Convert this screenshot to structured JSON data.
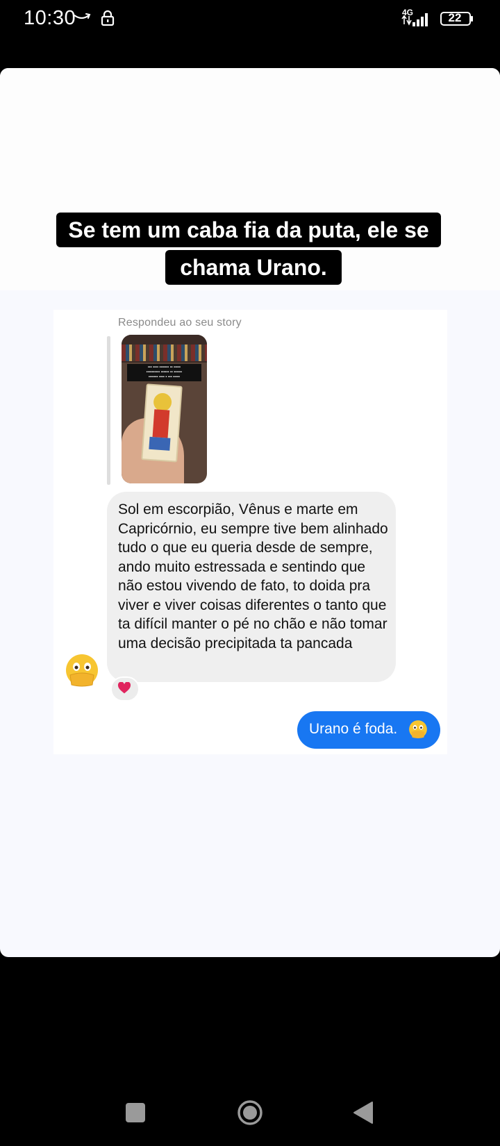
{
  "status_bar": {
    "time": "10:30",
    "network": "4G",
    "battery": "22",
    "icons": [
      "amazon-icon",
      "lock-icon",
      "signal-icon",
      "battery-icon"
    ]
  },
  "story": {
    "caption_line1": "Se tem um caba fia da puta, ele se",
    "caption_line2": "chama Urano."
  },
  "dm": {
    "reply_label": "Respondeu ao seu story",
    "incoming_message": "Sol em escorpião, Vênus e marte em Capricórnio, eu sempre tive bem alinhado tudo o que eu queria desde de sempre, ando muito estressada e sentindo que não estou vivendo de fato, to doida pra viver e viver coisas diferentes o tanto que ta difícil manter o pé no chão e não tomar uma decisão precipitada ta pancada",
    "reaction": "heart-icon",
    "outgoing_message": "Urano é foda.",
    "outgoing_emoji": "face-with-open-eyes-and-hand-over-mouth-icon",
    "avatar_emoji": "face-with-open-eyes-and-hand-over-mouth-icon"
  },
  "nav_bar": {
    "buttons": [
      "recents-button",
      "home-button",
      "back-button"
    ]
  },
  "colors": {
    "outgoing_bubble": "#1877f2",
    "incoming_bubble": "#efefef",
    "heart": "#e0245e"
  }
}
